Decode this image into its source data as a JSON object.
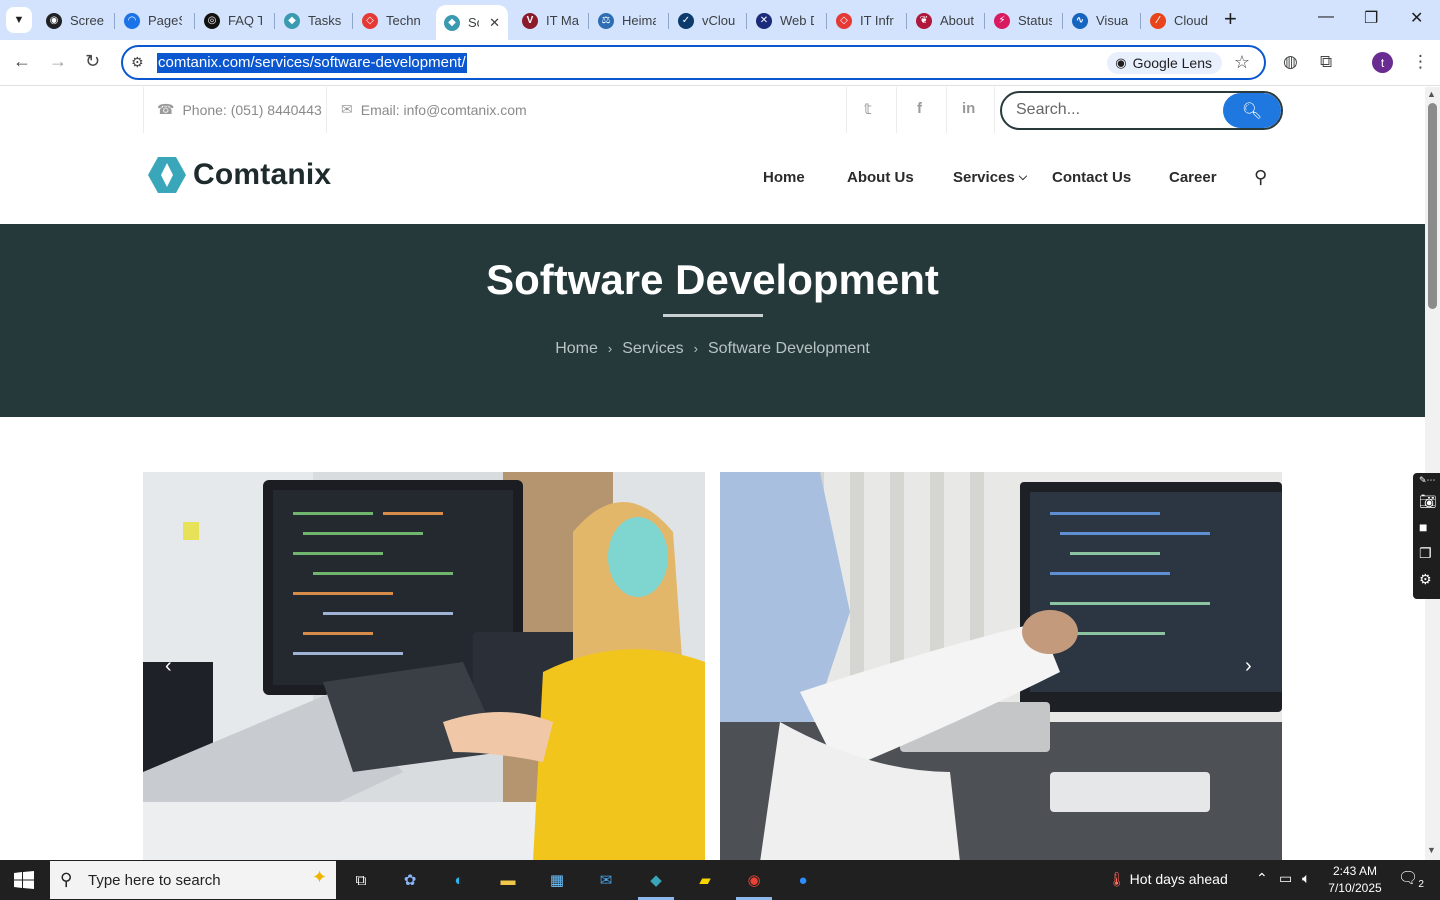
{
  "browser": {
    "tabs": [
      {
        "label": "Scree",
        "fav_color": "#202124",
        "fav_glyph": "◉"
      },
      {
        "label": "PageS",
        "fav_color": "#1a73e8",
        "fav_glyph": "◠"
      },
      {
        "label": "FAQ T",
        "fav_color": "#111111",
        "fav_glyph": "◎"
      },
      {
        "label": "Tasks",
        "fav_color": "#3a9ab0",
        "fav_glyph": "◆"
      },
      {
        "label": "Techn",
        "fav_color": "#e53935",
        "fav_glyph": "◇"
      },
      {
        "label": "Sc",
        "fav_color": "#3a9ab0",
        "fav_glyph": "◆",
        "active": true
      },
      {
        "label": "IT Ma",
        "fav_color": "#8b1a2b",
        "fav_glyph": "V"
      },
      {
        "label": "Heima",
        "fav_color": "#2c6db3",
        "fav_glyph": "⚖"
      },
      {
        "label": "vClou",
        "fav_color": "#0b3a6b",
        "fav_glyph": "✓"
      },
      {
        "label": "Web D",
        "fav_color": "#1b2a7a",
        "fav_glyph": "✕"
      },
      {
        "label": "IT Infr",
        "fav_color": "#e53935",
        "fav_glyph": "◇"
      },
      {
        "label": "About",
        "fav_color": "#b0173b",
        "fav_glyph": "❦"
      },
      {
        "label": "Status",
        "fav_color": "#d81b60",
        "fav_glyph": "⚡"
      },
      {
        "label": "Visua",
        "fav_color": "#1565c0",
        "fav_glyph": "∿"
      },
      {
        "label": "Cloud",
        "fav_color": "#e8431a",
        "fav_glyph": "⁄"
      }
    ],
    "new_tab": "+",
    "url": "comtanix.com/services/software-development/",
    "lens_label": "Google Lens",
    "profile_initial": "t"
  },
  "site": {
    "phone": "Phone: (051) 8440443",
    "email": "Email: info@comtanix.com",
    "social": [
      "twitter",
      "facebook",
      "linkedin"
    ],
    "search_placeholder": "Search...",
    "brand": "Comtanix",
    "nav": [
      "Home",
      "About Us",
      "Services",
      "Contact Us",
      "Career"
    ],
    "hero_title": "Software Development",
    "breadcrumb": [
      "Home",
      "Services",
      "Software Development"
    ],
    "accent": "#1f77e0",
    "hero_bg": "#25393b"
  },
  "taskbar": {
    "search_text": "Type here to search",
    "weather": "Hot days ahead",
    "time": "2:43 AM",
    "date": "7/10/2025",
    "notif_count": "2"
  }
}
